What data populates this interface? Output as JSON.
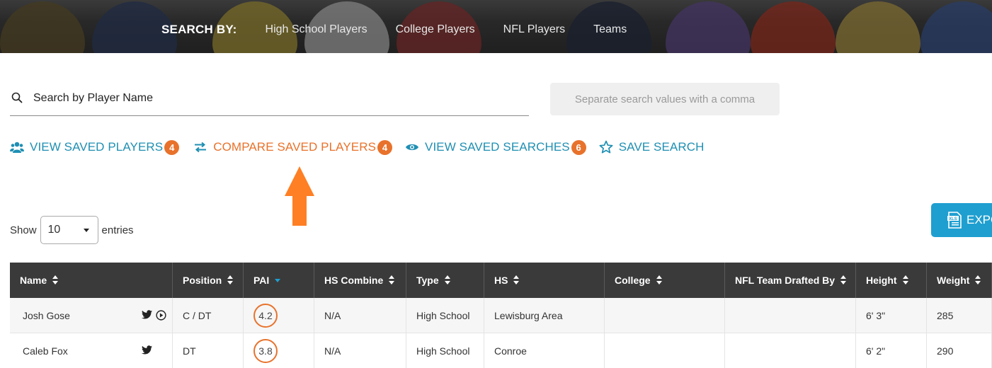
{
  "header": {
    "search_by_label": "SEARCH BY:",
    "nav": [
      "High School Players",
      "College Players",
      "NFL Players",
      "Teams"
    ]
  },
  "search": {
    "placeholder": "Search by Player Name",
    "multi_placeholder": "Separate search values with a comma"
  },
  "actions": {
    "view_saved_players": {
      "label": "VIEW SAVED PLAYERS",
      "count": "4",
      "icon": "users-icon"
    },
    "compare_saved_players": {
      "label": "COMPARE SAVED PLAYERS",
      "count": "4",
      "icon": "swap-arrows-icon"
    },
    "view_saved_searches": {
      "label": "VIEW SAVED SEARCHES",
      "count": "6",
      "icon": "eye-icon"
    },
    "save_search": {
      "label": "SAVE SEARCH",
      "icon": "star-icon"
    }
  },
  "entries": {
    "show_label": "Show",
    "value": "10",
    "entries_label": "entries"
  },
  "export": {
    "label": "EXPO",
    "icon": "xls-icon"
  },
  "table": {
    "columns": [
      "Name",
      "Position",
      "PAI",
      "HS Combine",
      "Type",
      "HS",
      "College",
      "NFL Team Drafted By",
      "Height",
      "Weight"
    ],
    "rows": [
      {
        "name": "Josh Gose",
        "position": "C / DT",
        "pai": "4.2",
        "hs_combine": "N/A",
        "type": "High School",
        "hs": "Lewisburg Area",
        "college": "",
        "nfl_team": "",
        "height": "6' 3\"",
        "weight": "285",
        "icons": [
          "twitter-icon",
          "play-icon"
        ]
      },
      {
        "name": "Caleb Fox",
        "position": "DT",
        "pai": "3.8",
        "hs_combine": "N/A",
        "type": "High School",
        "hs": "Conroe",
        "college": "",
        "nfl_team": "",
        "height": "6' 2\"",
        "weight": "290",
        "icons": [
          "twitter-icon"
        ]
      }
    ]
  },
  "colors": {
    "accent_teal": "#1f8fb3",
    "accent_orange": "#e8722b",
    "header_dark": "#3a3a3a",
    "export_blue": "#1f9fd0"
  }
}
